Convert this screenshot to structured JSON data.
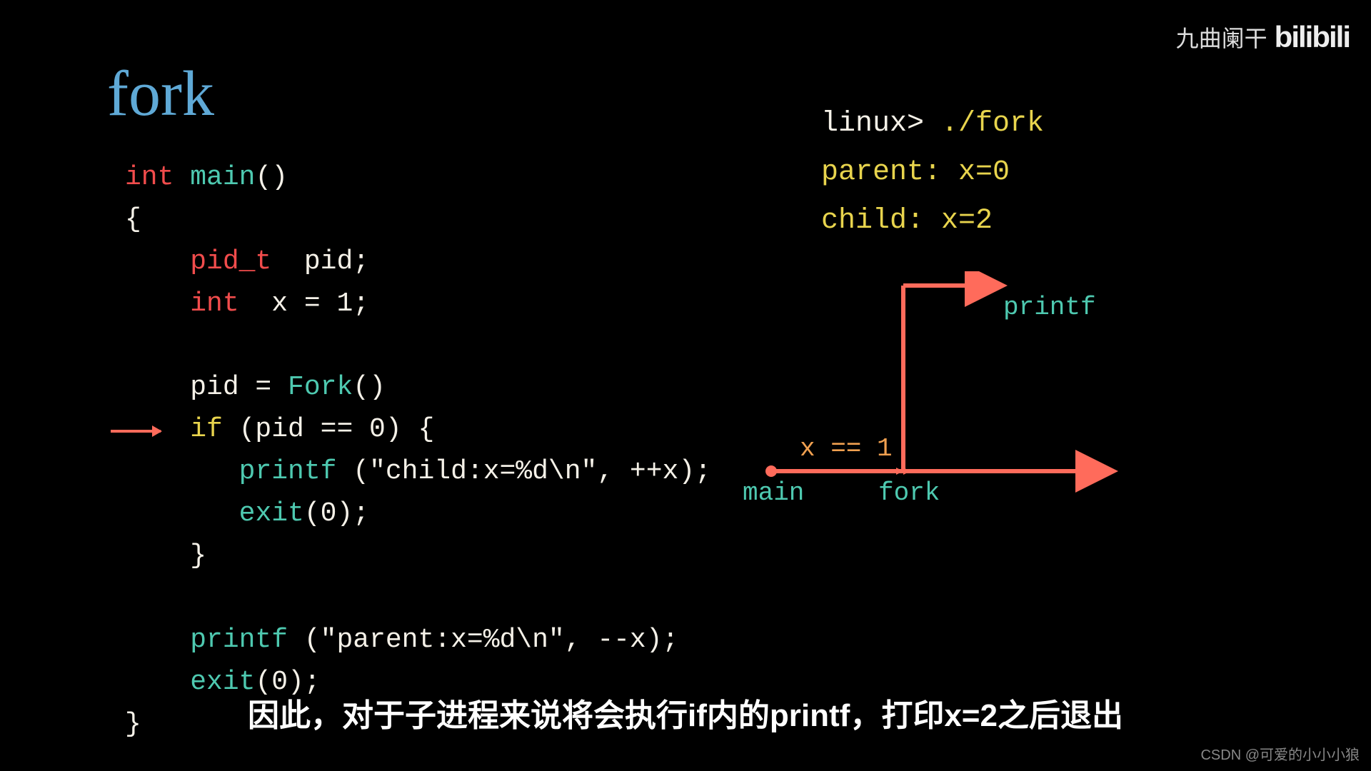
{
  "title": "fork",
  "code": {
    "l1": {
      "t1": "int",
      "t2": "main",
      "t3": "()"
    },
    "l2": {
      "t": "{"
    },
    "l3": {
      "t1": "pid_t",
      "t2": "  pid;"
    },
    "l4": {
      "t1": "int",
      "t2": "  x = 1;"
    },
    "l5": {
      "t1": "pid = ",
      "t2": "Fork",
      "t3": "()"
    },
    "l6": {
      "t1": "if",
      "t2": " (pid == 0) ",
      "t3": "{"
    },
    "l7": {
      "t1": "printf",
      "t2": " (\"child:x=%d\\n\", ++x);"
    },
    "l8": {
      "t1": "exit",
      "t2": "(0);"
    },
    "l9": {
      "t": "}"
    },
    "l10": {
      "t1": "printf",
      "t2": " (\"parent:x=%d\\n\", --x);"
    },
    "l11": {
      "t1": "exit",
      "t2": "(0);"
    },
    "l12": {
      "t": "}"
    }
  },
  "terminal": {
    "prompt": "linux> ",
    "cmd": "./fork",
    "out1": "parent: x=0",
    "out2": "child: x=2"
  },
  "diagram": {
    "x_label": "x == 1",
    "main": "main",
    "fork": "fork",
    "printf": "printf"
  },
  "caption": "因此，对于子进程来说将会执行if内的printf，打印x=2之后退出",
  "watermark_tr": "九曲阑干",
  "watermark_bili": "bilibili",
  "watermark_br": "CSDN @可爱的小小小狼"
}
